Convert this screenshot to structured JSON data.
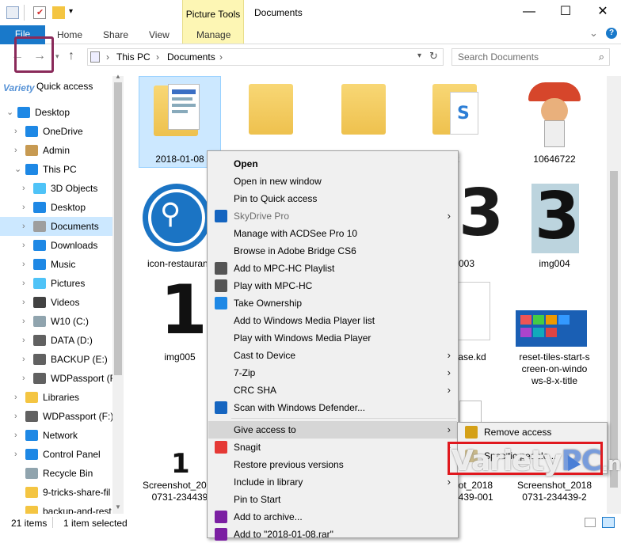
{
  "window": {
    "title": "Documents",
    "contextual_tab_group": "Picture Tools",
    "minimize": "—",
    "maximize": "☐",
    "close": "✕"
  },
  "ribbon": {
    "tabs": [
      "File",
      "Home",
      "Share",
      "View",
      "Manage"
    ],
    "collapse": "⌄",
    "help": "?"
  },
  "address": {
    "path": [
      "This PC",
      "Documents"
    ],
    "search_placeholder": "Search Documents"
  },
  "nav_pane": {
    "quick_access": "Quick access",
    "items": [
      {
        "label": "Desktop",
        "expanded": true,
        "indent": 0,
        "icon": "desktop-icon",
        "color": "#1e88e5"
      },
      {
        "label": "OneDrive",
        "expanded": false,
        "indent": 1,
        "icon": "cloud-icon",
        "color": "#1e88e5"
      },
      {
        "label": "Admin",
        "expanded": false,
        "indent": 1,
        "icon": "user-icon",
        "color": "#c79a52"
      },
      {
        "label": "This PC",
        "expanded": true,
        "indent": 1,
        "icon": "computer-icon",
        "color": "#1e88e5"
      },
      {
        "label": "3D Objects",
        "expanded": false,
        "indent": 2,
        "icon": "cube-icon",
        "color": "#4fc3f7"
      },
      {
        "label": "Desktop",
        "expanded": false,
        "indent": 2,
        "icon": "desktop-icon",
        "color": "#1e88e5"
      },
      {
        "label": "Documents",
        "expanded": false,
        "indent": 2,
        "icon": "document-icon",
        "color": "#9e9e9e",
        "selected": true
      },
      {
        "label": "Downloads",
        "expanded": false,
        "indent": 2,
        "icon": "download-icon",
        "color": "#1e88e5"
      },
      {
        "label": "Music",
        "expanded": false,
        "indent": 2,
        "icon": "music-icon",
        "color": "#1e88e5"
      },
      {
        "label": "Pictures",
        "expanded": false,
        "indent": 2,
        "icon": "pictures-icon",
        "color": "#4fc3f7"
      },
      {
        "label": "Videos",
        "expanded": false,
        "indent": 2,
        "icon": "video-icon",
        "color": "#424242"
      },
      {
        "label": "W10 (C:)",
        "expanded": false,
        "indent": 2,
        "icon": "drive-icon",
        "color": "#90a4ae"
      },
      {
        "label": "DATA (D:)",
        "expanded": false,
        "indent": 2,
        "icon": "drive-icon",
        "color": "#616161"
      },
      {
        "label": "BACKUP (E:)",
        "expanded": false,
        "indent": 2,
        "icon": "drive-icon",
        "color": "#616161"
      },
      {
        "label": "WDPassport (F:)",
        "expanded": false,
        "indent": 2,
        "icon": "drive-icon",
        "color": "#616161"
      },
      {
        "label": "Libraries",
        "expanded": false,
        "indent": 1,
        "icon": "library-icon",
        "color": "#f4c542"
      },
      {
        "label": "WDPassport (F:)",
        "expanded": false,
        "indent": 1,
        "icon": "drive-icon",
        "color": "#616161"
      },
      {
        "label": "Network",
        "expanded": false,
        "indent": 1,
        "icon": "network-icon",
        "color": "#1e88e5"
      },
      {
        "label": "Control Panel",
        "expanded": false,
        "indent": 1,
        "icon": "control-panel-icon",
        "color": "#1e88e5"
      },
      {
        "label": "Recycle Bin",
        "expanded": false,
        "indent": 1,
        "icon": "recycle-bin-icon",
        "color": "#90a4ae",
        "nochev": true
      },
      {
        "label": "9-tricks-share-fil",
        "expanded": false,
        "indent": 1,
        "icon": "folder-icon",
        "color": "#f4c542",
        "nochev": true
      },
      {
        "label": "backup-and-rest",
        "expanded": false,
        "indent": 1,
        "icon": "folder-icon",
        "color": "#f4c542",
        "nochev": true
      }
    ]
  },
  "files": [
    {
      "caption": "2018-01-08",
      "kind": "folder-photo"
    },
    {
      "caption": "",
      "kind": "folder"
    },
    {
      "caption": "",
      "kind": "folder"
    },
    {
      "caption": "agit",
      "kind": "folder-snagit"
    },
    {
      "caption": "10646722",
      "kind": "photo"
    },
    {
      "caption": "icon-restaurant",
      "kind": "restaurant"
    },
    {
      "caption": "003",
      "kind": "digit"
    },
    {
      "caption": "img004",
      "kind": "digit"
    },
    {
      "caption": "img005",
      "kind": "digit"
    },
    {
      "caption": "abase.kd\nx",
      "kind": "doc"
    },
    {
      "caption": "reset-tiles-start-s\ncreen-on-windo\nws-8-x-title",
      "kind": "tiles"
    },
    {
      "caption": "Screenshot_2018\n0731-234439",
      "kind": "screenshot"
    },
    {
      "caption": "hot_2018\n4439-001",
      "kind": "screenshot"
    },
    {
      "caption": "Screenshot_2018\n0731-234439-2",
      "kind": "screenshot"
    }
  ],
  "digits": {
    "d3a": "3",
    "d3b": "3",
    "d1": "1",
    "d1b": "1"
  },
  "context_menu": {
    "items": [
      {
        "label": "Open",
        "bold": true
      },
      {
        "label": "Open in new window"
      },
      {
        "label": "Pin to Quick access"
      },
      {
        "label": "SkyDrive Pro",
        "disabled": true,
        "submenu": true,
        "icon": "skydrive-icon",
        "icon_color": "#1565c0"
      },
      {
        "label": "Manage with ACDSee Pro 10"
      },
      {
        "label": "Browse in Adobe Bridge CS6"
      },
      {
        "label": "Add to MPC-HC Playlist",
        "icon": "mpc-hc-icon",
        "icon_color": "#555555"
      },
      {
        "label": "Play with MPC-HC",
        "icon": "mpc-hc-icon",
        "icon_color": "#555555"
      },
      {
        "label": "Take Ownership",
        "icon": "shield-icon",
        "icon_color": "#1e88e5"
      },
      {
        "label": "Add to Windows Media Player list"
      },
      {
        "label": "Play with Windows Media Player"
      },
      {
        "label": "Cast to Device",
        "submenu": true
      },
      {
        "label": "7-Zip",
        "submenu": true
      },
      {
        "label": "CRC SHA",
        "submenu": true
      },
      {
        "label": "Scan with Windows Defender...",
        "icon": "defender-icon",
        "icon_color": "#1565c0"
      },
      {
        "label": "Give access to",
        "submenu": true,
        "highlighted": true,
        "sep_before": true
      },
      {
        "label": "Snagit",
        "submenu": true,
        "icon": "snagit-icon",
        "icon_color": "#e53935"
      },
      {
        "label": "Restore previous versions"
      },
      {
        "label": "Include in library",
        "submenu": true
      },
      {
        "label": "Pin to Start"
      },
      {
        "label": "Add to archive...",
        "icon": "winrar-icon",
        "icon_color": "#7b1fa2"
      },
      {
        "label": "Add to \"2018-01-08.rar\"",
        "icon": "winrar-icon",
        "icon_color": "#7b1fa2"
      }
    ]
  },
  "submenu": {
    "items": [
      {
        "label": "Remove access",
        "icon": "lock-icon"
      },
      {
        "label": "Specific people...",
        "icon": "people-icon"
      }
    ]
  },
  "status": {
    "count": "21 items",
    "selected": "1 item selected"
  },
  "watermark": {
    "text_a": "Variety",
    "text_b": "PC",
    "text_c": ".net"
  }
}
